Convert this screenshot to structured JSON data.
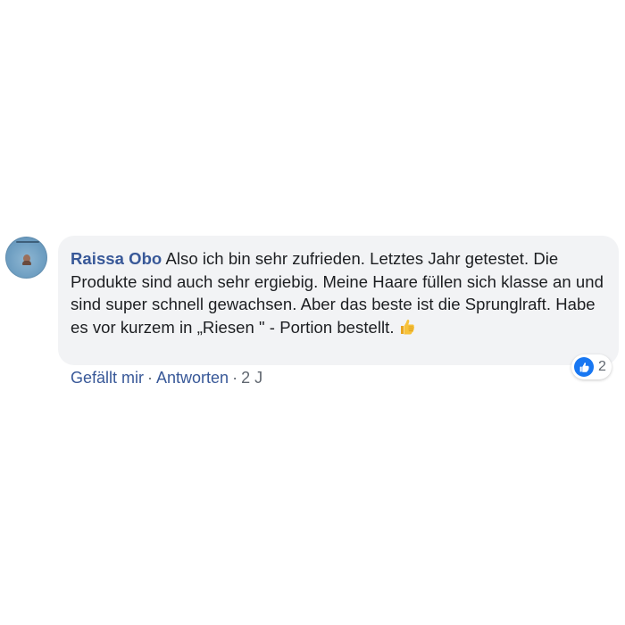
{
  "comment": {
    "author": "Raissa Obo",
    "text": "Also ich bin sehr zufrieden. Letztes Jahr getestet. Die Produkte sind auch sehr ergiebig. Meine Haare füllen sich klasse an und sind super schnell gewachsen. Aber das beste ist die Sprunglraft. Habe es vor kurzem in „Riesen \" - Portion bestellt.",
    "emoji": "thumbs-up-icon",
    "reaction_icon": "like-icon",
    "reaction_count": "2"
  },
  "actions": {
    "like_label": "Gefällt mir",
    "separator": "·",
    "reply_label": "Antworten",
    "timestamp": "2 J"
  },
  "colors": {
    "author": "#385898",
    "bubble": "#f2f3f5",
    "like_badge": "#1877f2",
    "meta": "#606770"
  }
}
